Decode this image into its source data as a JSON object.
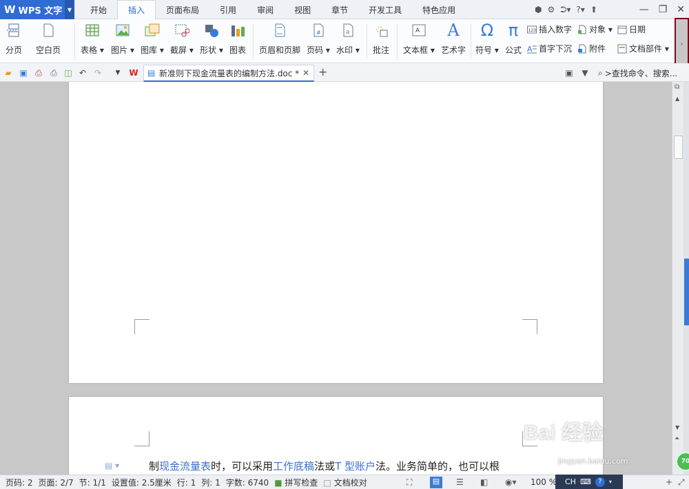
{
  "app": {
    "logo": "W",
    "name": "WPS 文字"
  },
  "tabs": [
    "开始",
    "插入",
    "页面布局",
    "引用",
    "审阅",
    "视图",
    "章节",
    "开发工具",
    "特色应用"
  ],
  "active_tab": "插入",
  "ribbon": {
    "page_break": "分页",
    "blank_page": "空白页",
    "table": "表格",
    "picture": "图片",
    "gallery": "图库",
    "screenshot": "截屏",
    "shape": "形状",
    "chart": "图表",
    "header_footer": "页眉和页脚",
    "page_number": "页码",
    "watermark": "水印",
    "comment": "批注",
    "textbox": "文本框",
    "wordart": "艺术字",
    "symbol": "符号",
    "formula": "公式",
    "insert_number": "插入数字",
    "object": "对象",
    "date": "日期",
    "drop_cap": "首字下沉",
    "attachment": "附件",
    "doc_parts": "文档部件"
  },
  "document_tab": {
    "name": "新准则下现金流量表的编制方法.doc *"
  },
  "search": {
    "placeholder": ">查找命令、搜索..."
  },
  "page2": {
    "t1": "制",
    "l1": "现金流量表",
    "t2": "时，可以采用",
    "l2": "工作底稿",
    "t3": "法或",
    "l3": "T 型账户",
    "t4": "法。业务简单的，也可以根"
  },
  "status": {
    "page": "页码: 2",
    "pages": "页面: 2/7",
    "section": "节: 1/1",
    "setting": "设置值: 2.5厘米",
    "row": "行: 1",
    "col": "列: 1",
    "words": "字数: 6740",
    "spell": "拼写检查",
    "proof": "文档校对",
    "zoom": "100 %"
  },
  "ime": {
    "lang": "CH"
  },
  "badge": {
    "value": "70"
  },
  "watermark": {
    "text": "Bai 经验",
    "url": "jingyan.baidu.com"
  },
  "colors": {
    "accent": "#2f6cd4",
    "link": "#3a6fd0"
  }
}
